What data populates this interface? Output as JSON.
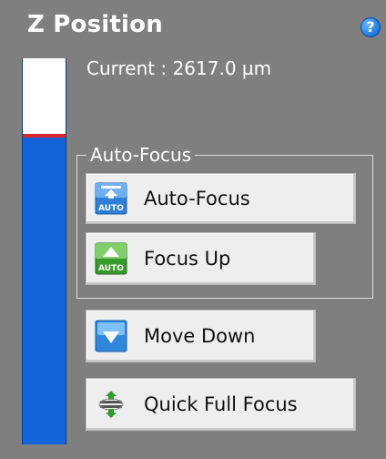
{
  "panel": {
    "title": "Z Position",
    "help_glyph": "?",
    "current_label": "Current : 2617.0 µm",
    "z_level_fraction": 0.2
  },
  "autofocus_group": {
    "legend": "Auto-Focus",
    "buttons": [
      {
        "label": "Auto-Focus",
        "icon": "auto-focus-icon"
      },
      {
        "label": "Focus Up",
        "icon": "focus-up-auto-icon"
      }
    ]
  },
  "move_down": {
    "label": "Move Down",
    "icon": "move-down-icon"
  },
  "quick_full_focus": {
    "label": "Quick Full Focus",
    "icon": "quick-full-focus-icon"
  },
  "colors": {
    "panel_bg": "#7f7f7f",
    "z_bar_fill": "#1563d8",
    "z_indicator": "#d7272a",
    "help_blue": "#1b74d6",
    "auto_blue": "#2f7fd6",
    "auto_green": "#3a9a2c"
  }
}
